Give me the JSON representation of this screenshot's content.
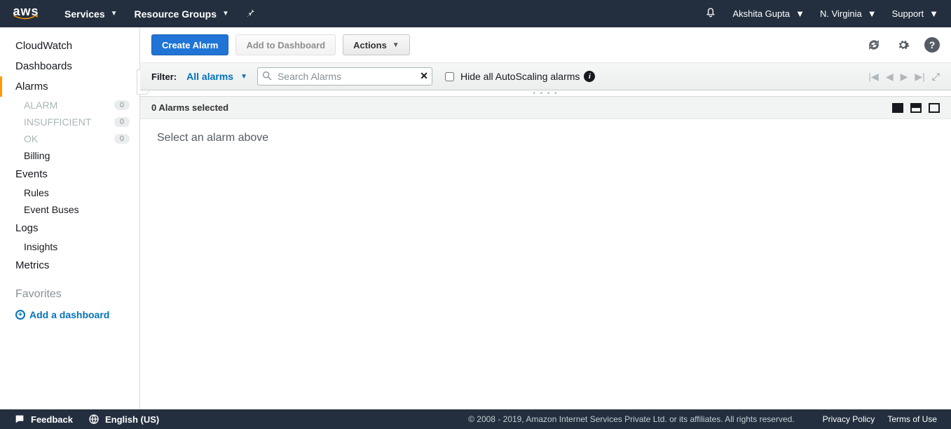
{
  "topbar": {
    "logo_text": "aws",
    "services": "Services",
    "resource_groups": "Resource Groups",
    "user": "Akshita Gupta",
    "region": "N. Virginia",
    "support": "Support"
  },
  "sidebar": {
    "items": [
      {
        "label": "CloudWatch"
      },
      {
        "label": "Dashboards"
      },
      {
        "label": "Alarms"
      },
      {
        "label": "Events"
      },
      {
        "label": "Logs"
      },
      {
        "label": "Metrics"
      }
    ],
    "alarm_subs": [
      {
        "label": "ALARM",
        "count": "0"
      },
      {
        "label": "INSUFFICIENT",
        "count": "0"
      },
      {
        "label": "OK",
        "count": "0"
      },
      {
        "label": "Billing"
      }
    ],
    "event_subs": [
      {
        "label": "Rules"
      },
      {
        "label": "Event Buses"
      }
    ],
    "log_subs": [
      {
        "label": "Insights"
      }
    ],
    "favorites_label": "Favorites",
    "add_dashboard": "Add a dashboard"
  },
  "toolbar": {
    "create": "Create Alarm",
    "add_to_dashboard": "Add to Dashboard",
    "actions": "Actions"
  },
  "filter": {
    "label": "Filter:",
    "value": "All alarms",
    "search_placeholder": "Search Alarms",
    "hide_label": "Hide all AutoScaling alarms"
  },
  "selectbar": {
    "text": "0 Alarms selected"
  },
  "detail": {
    "placeholder": "Select an alarm above"
  },
  "footer": {
    "feedback": "Feedback",
    "language": "English (US)",
    "copyright": "© 2008 - 2019, Amazon Internet Services Private Ltd. or its affiliates. All rights reserved.",
    "privacy": "Privacy Policy",
    "terms": "Terms of Use"
  }
}
